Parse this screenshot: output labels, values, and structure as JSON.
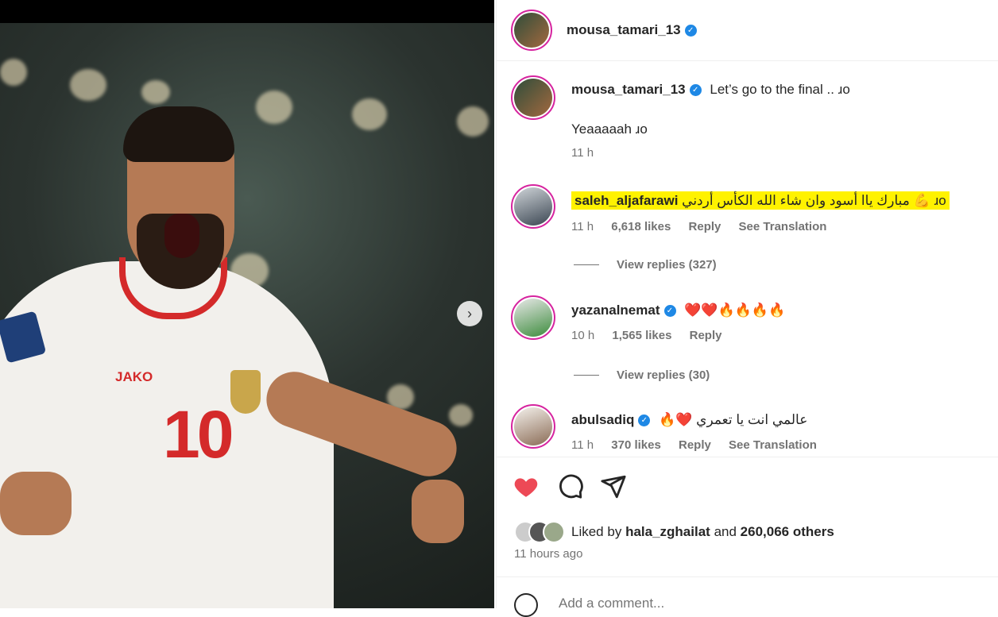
{
  "post": {
    "author": "mousa_tamari_13"
  },
  "caption": {
    "username": "mousa_tamari_13",
    "line1": "Let’s go to the final .. ⁠ɹo",
    "line2": "Yeaaaaah ɹo",
    "time": "11 h"
  },
  "comments": [
    {
      "username": "saleh_aljafarawi",
      "text": "مبارك ياا أسود وان شاء الله الكأس أردني 💪 ɹo",
      "time": "11 h",
      "likes": "6,618 likes",
      "reply": "Reply",
      "translate": "See Translation",
      "view_replies": "View replies (327)"
    },
    {
      "username": "yazanalnemat",
      "text": "❤️❤️🔥🔥🔥🔥",
      "time": "10 h",
      "likes": "1,565 likes",
      "reply": "Reply",
      "view_replies": "View replies (30)"
    },
    {
      "username": "abulsadiq",
      "text": "🔥❤️ عالمي انت يا تعمري",
      "time": "11 h",
      "likes": "370 likes",
      "reply": "Reply",
      "translate": "See Translation"
    }
  ],
  "likes": {
    "prefix": "Liked by",
    "user": "hala_zghailat",
    "and": "and",
    "others": "260,066 others"
  },
  "time_ago": "11 hours ago",
  "add_comment_placeholder": "Add a comment...",
  "photo": {
    "jersey_brand": "JAKO",
    "jersey_number": "10"
  },
  "colors": {
    "like_red": "#ed4956",
    "verified_blue": "#1e88e5",
    "highlight": "#fff200"
  }
}
